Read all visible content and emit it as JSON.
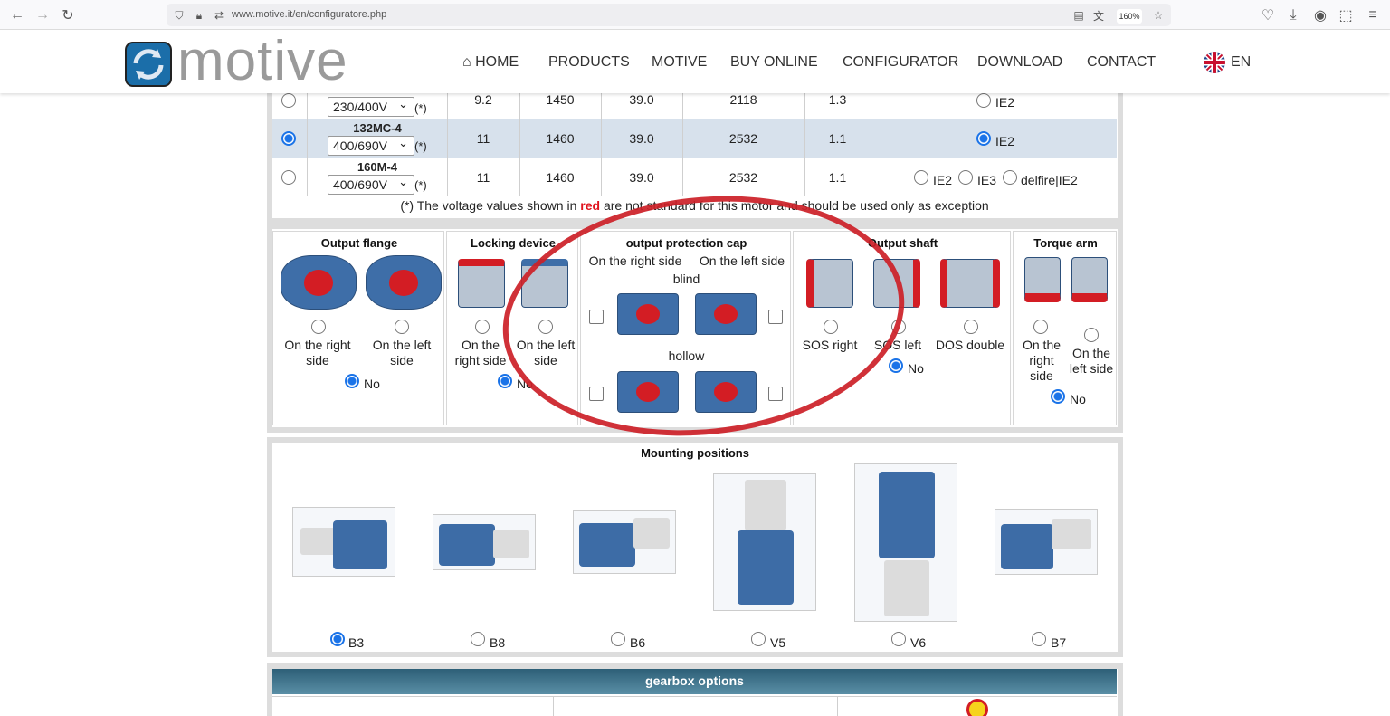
{
  "browser": {
    "url": "www.motive.it/en/configuratore.php",
    "zoom": "160%"
  },
  "brand": {
    "name": "motive"
  },
  "nav": {
    "home": "HOME",
    "products": "PRODUCTS",
    "motive": "MOTIVE",
    "buy": "BUY ONLINE",
    "configurator": "CONFIGURATOR",
    "download": "DOWNLOAD",
    "contact": "CONTACT",
    "lang": "EN"
  },
  "motors": {
    "rows": [
      {
        "name": "",
        "voltage": "230/400V",
        "mark": "(*)",
        "c1": "9.2",
        "c2": "1450",
        "c3": "39.0",
        "c4": "2118",
        "c5": "1.3",
        "effs": [
          "IE2"
        ],
        "selected": false
      },
      {
        "name": "132MC-4",
        "voltage": "400/690V",
        "mark": "(*)",
        "c1": "11",
        "c2": "1460",
        "c3": "39.0",
        "c4": "2532",
        "c5": "1.1",
        "effs": [
          "IE2"
        ],
        "selected": true
      },
      {
        "name": "160M-4",
        "voltage": "400/690V",
        "mark": "(*)",
        "c1": "11",
        "c2": "1460",
        "c3": "39.0",
        "c4": "2532",
        "c5": "1.1",
        "effs": [
          "IE2",
          "IE3",
          "delfire|IE2"
        ],
        "selected": false
      }
    ],
    "note_pre": "(*) The voltage values shown in ",
    "note_red": "red",
    "note_post": " are not standard for this motor and should be used only as exception"
  },
  "options": {
    "output_flange": {
      "title": "Output flange",
      "right": "On the right side",
      "left": "On the left side",
      "no": "No"
    },
    "locking": {
      "title": "Locking device",
      "right": "On the right side",
      "left": "On the left side",
      "no": "No"
    },
    "cap": {
      "title": "output protection cap",
      "right": "On the right side",
      "left": "On the left side",
      "blind": "blind",
      "hollow": "hollow"
    },
    "shaft": {
      "title": "Output shaft",
      "sos_right": "SOS right",
      "sos_left": "SOS left",
      "dos": "DOS double",
      "no": "No"
    },
    "torque": {
      "title": "Torque arm",
      "right": "On the right side",
      "left": "On the left side",
      "no": "No"
    }
  },
  "mounting": {
    "title": "Mounting positions",
    "items": [
      "B3",
      "B8",
      "B6",
      "V5",
      "V6",
      "B7"
    ],
    "selected": "B3"
  },
  "gearbox": {
    "title": "gearbox options"
  },
  "colors": {
    "accent": "#1a73e8",
    "annotation": "#cc2027",
    "banner": "#2d5f77"
  }
}
